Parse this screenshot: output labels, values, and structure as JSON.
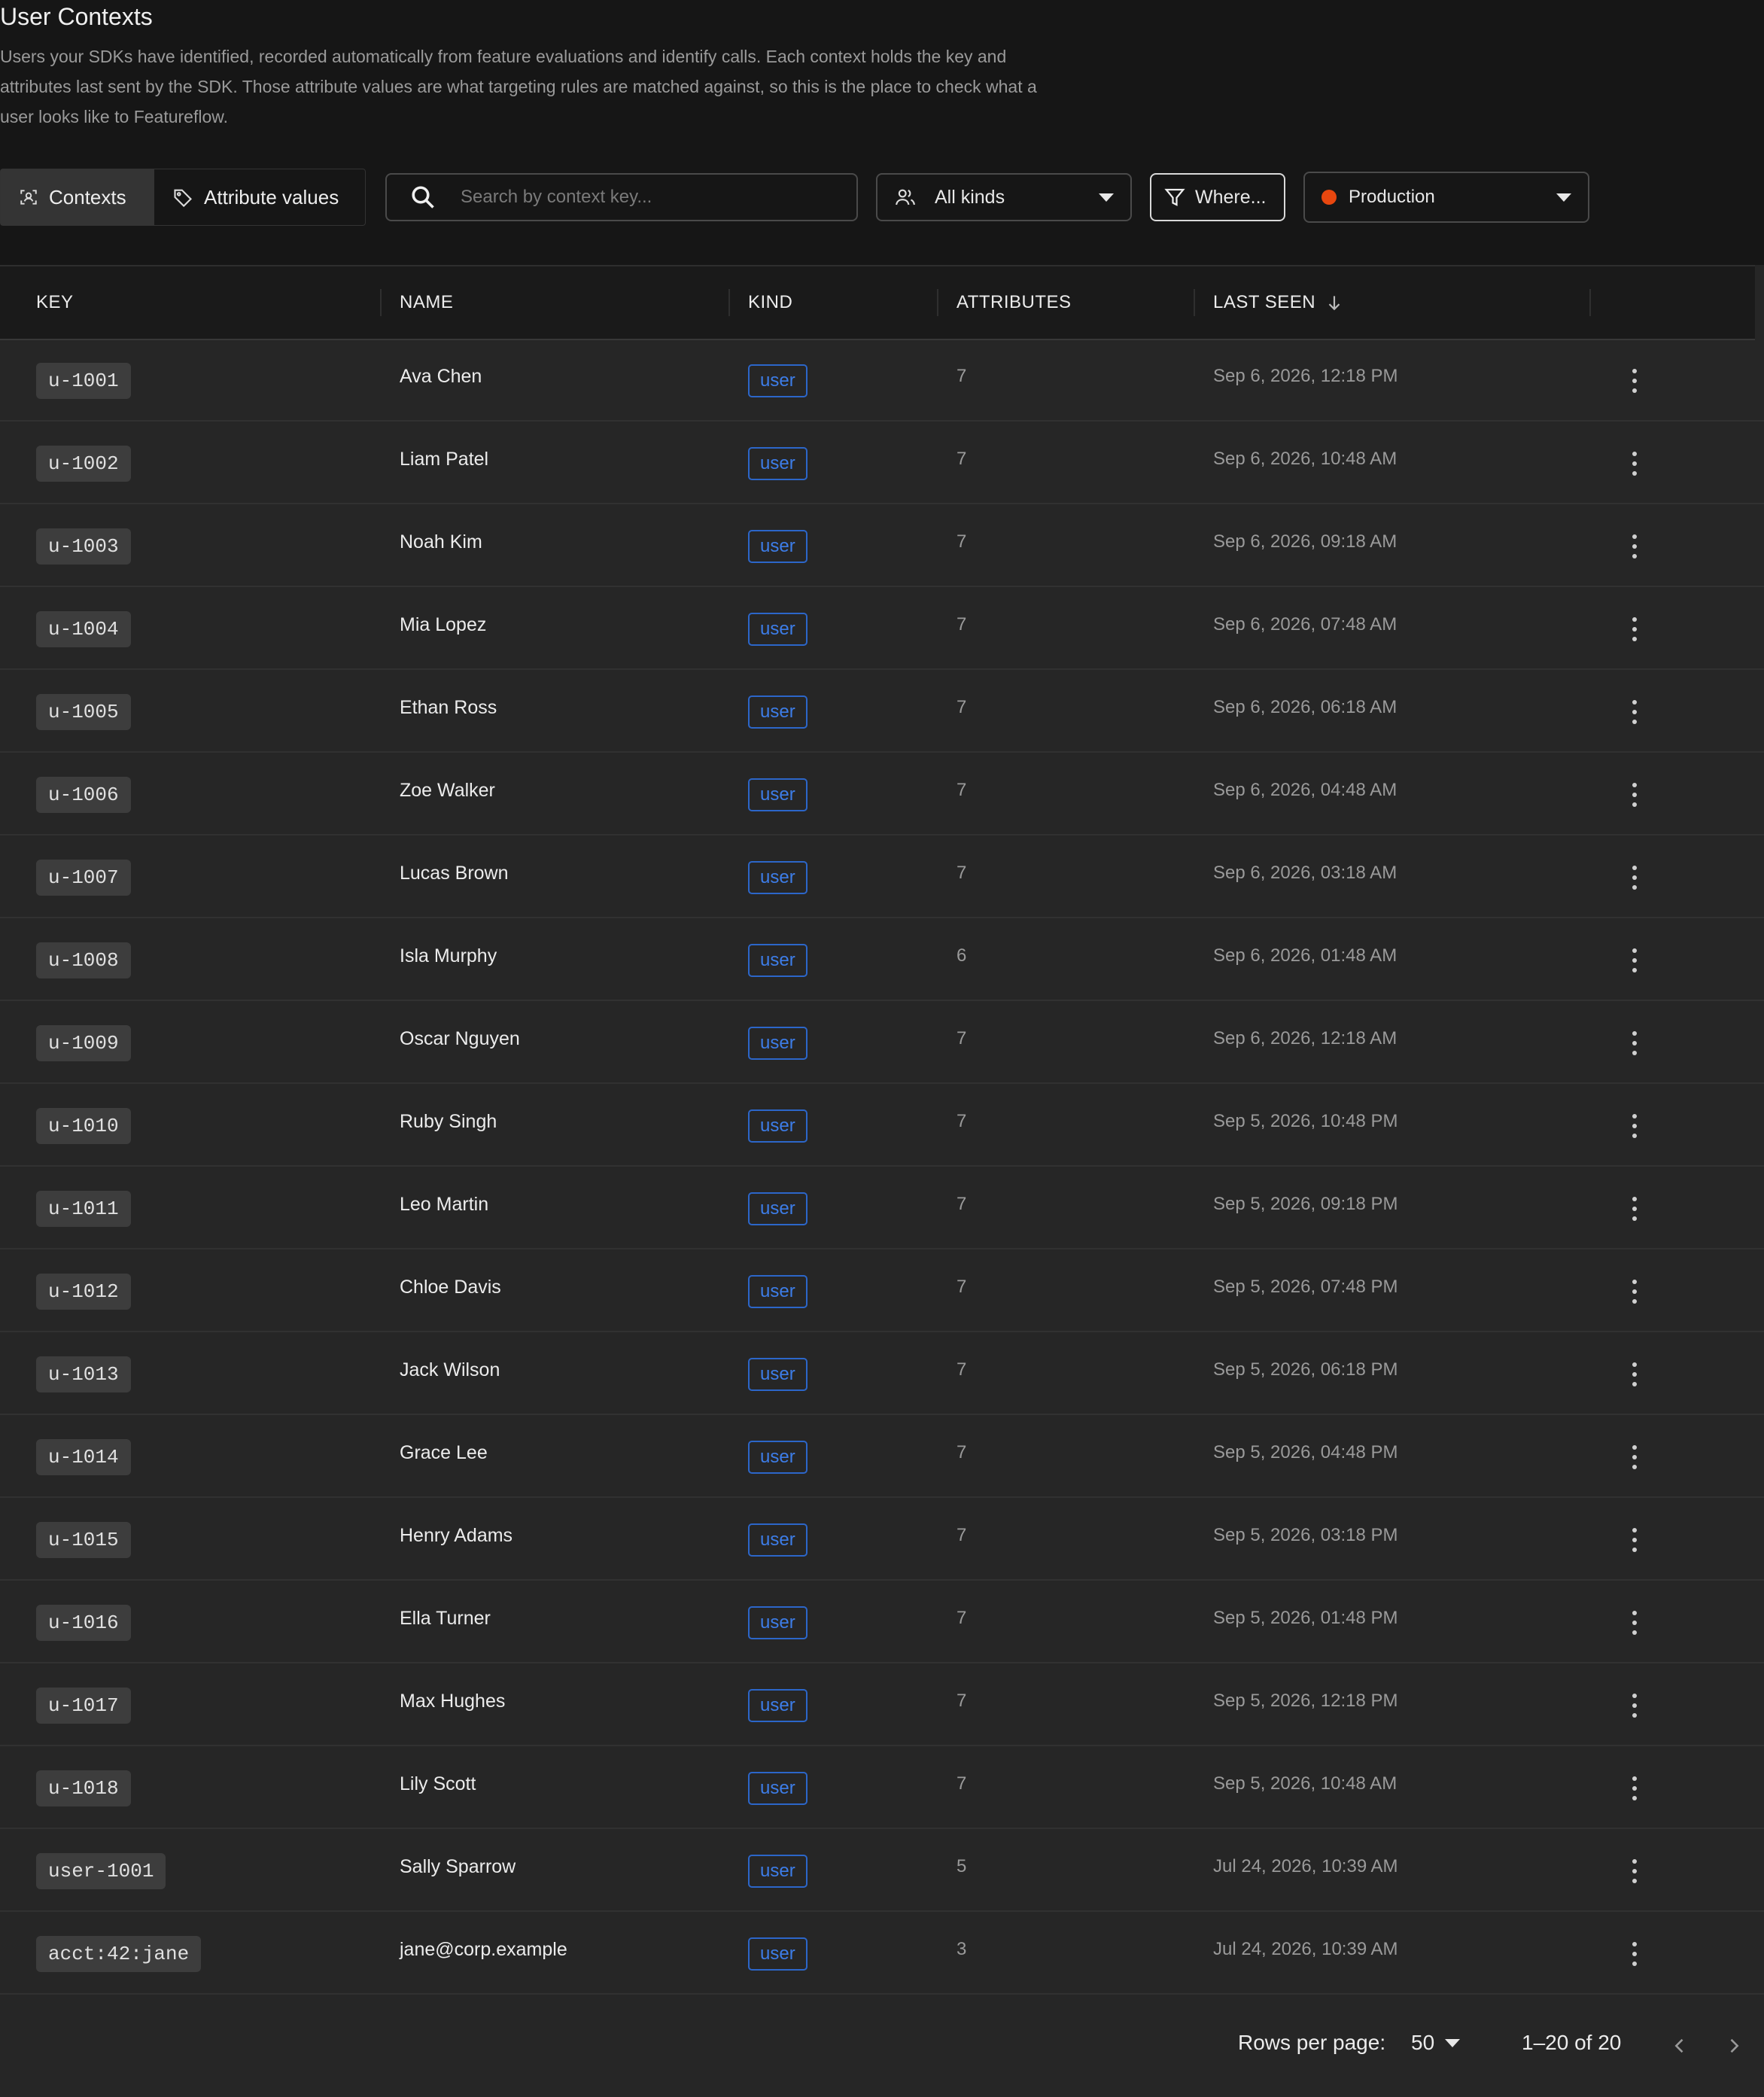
{
  "page": {
    "title": "User Contexts",
    "description": "Users your SDKs have identified, recorded automatically from feature evaluations and identify calls. Each context holds the key and attributes last sent by the SDK. Those attribute values are what targeting rules are matched against, so this is the place to check what a user looks like to Featureflow."
  },
  "toolbar": {
    "tabs": [
      {
        "label": "Contexts",
        "icon": "contexts-icon",
        "active": true
      },
      {
        "label": "Attribute values",
        "icon": "tag-icon",
        "active": false
      }
    ],
    "search": {
      "placeholder": "Search by context key...",
      "value": ""
    },
    "kind_filter": {
      "label": "All kinds",
      "icon": "users-icon"
    },
    "where_filter": {
      "label": "Where...",
      "icon": "filter-icon"
    },
    "environment": {
      "label": "Production",
      "color": "#e8470f"
    }
  },
  "table": {
    "columns": [
      "KEY",
      "NAME",
      "KIND",
      "ATTRIBUTES",
      "LAST SEEN"
    ],
    "sort": {
      "column": "LAST SEEN",
      "direction": "desc"
    },
    "rows": [
      {
        "key": "u-1001",
        "name": "Ava Chen",
        "kind": "user",
        "attributes": "7",
        "last_seen": "Sep 6, 2026, 12:18 PM"
      },
      {
        "key": "u-1002",
        "name": "Liam Patel",
        "kind": "user",
        "attributes": "7",
        "last_seen": "Sep 6, 2026, 10:48 AM"
      },
      {
        "key": "u-1003",
        "name": "Noah Kim",
        "kind": "user",
        "attributes": "7",
        "last_seen": "Sep 6, 2026, 09:18 AM"
      },
      {
        "key": "u-1004",
        "name": "Mia Lopez",
        "kind": "user",
        "attributes": "7",
        "last_seen": "Sep 6, 2026, 07:48 AM"
      },
      {
        "key": "u-1005",
        "name": "Ethan Ross",
        "kind": "user",
        "attributes": "7",
        "last_seen": "Sep 6, 2026, 06:18 AM"
      },
      {
        "key": "u-1006",
        "name": "Zoe Walker",
        "kind": "user",
        "attributes": "7",
        "last_seen": "Sep 6, 2026, 04:48 AM"
      },
      {
        "key": "u-1007",
        "name": "Lucas Brown",
        "kind": "user",
        "attributes": "7",
        "last_seen": "Sep 6, 2026, 03:18 AM"
      },
      {
        "key": "u-1008",
        "name": "Isla Murphy",
        "kind": "user",
        "attributes": "6",
        "last_seen": "Sep 6, 2026, 01:48 AM"
      },
      {
        "key": "u-1009",
        "name": "Oscar Nguyen",
        "kind": "user",
        "attributes": "7",
        "last_seen": "Sep 6, 2026, 12:18 AM"
      },
      {
        "key": "u-1010",
        "name": "Ruby Singh",
        "kind": "user",
        "attributes": "7",
        "last_seen": "Sep 5, 2026, 10:48 PM"
      },
      {
        "key": "u-1011",
        "name": "Leo Martin",
        "kind": "user",
        "attributes": "7",
        "last_seen": "Sep 5, 2026, 09:18 PM"
      },
      {
        "key": "u-1012",
        "name": "Chloe Davis",
        "kind": "user",
        "attributes": "7",
        "last_seen": "Sep 5, 2026, 07:48 PM"
      },
      {
        "key": "u-1013",
        "name": "Jack Wilson",
        "kind": "user",
        "attributes": "7",
        "last_seen": "Sep 5, 2026, 06:18 PM"
      },
      {
        "key": "u-1014",
        "name": "Grace Lee",
        "kind": "user",
        "attributes": "7",
        "last_seen": "Sep 5, 2026, 04:48 PM"
      },
      {
        "key": "u-1015",
        "name": "Henry Adams",
        "kind": "user",
        "attributes": "7",
        "last_seen": "Sep 5, 2026, 03:18 PM"
      },
      {
        "key": "u-1016",
        "name": "Ella Turner",
        "kind": "user",
        "attributes": "7",
        "last_seen": "Sep 5, 2026, 01:48 PM"
      },
      {
        "key": "u-1017",
        "name": "Max Hughes",
        "kind": "user",
        "attributes": "7",
        "last_seen": "Sep 5, 2026, 12:18 PM"
      },
      {
        "key": "u-1018",
        "name": "Lily Scott",
        "kind": "user",
        "attributes": "7",
        "last_seen": "Sep 5, 2026, 10:48 AM"
      },
      {
        "key": "user-1001",
        "name": "Sally Sparrow",
        "kind": "user",
        "attributes": "5",
        "last_seen": "Jul 24, 2026, 10:39 AM"
      },
      {
        "key": "acct:42:jane",
        "name": "jane@corp.example",
        "kind": "user",
        "attributes": "3",
        "last_seen": "Jul 24, 2026, 10:39 AM"
      }
    ]
  },
  "pagination": {
    "rows_per_page_label": "Rows per page:",
    "rows_per_page": "50",
    "range": "1–20 of 20"
  }
}
